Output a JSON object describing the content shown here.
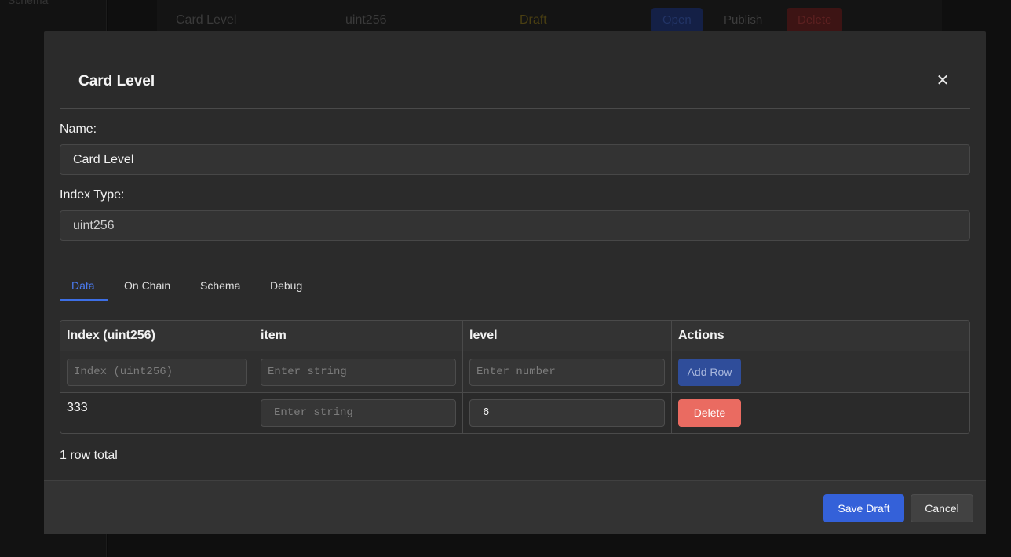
{
  "background": {
    "sidebar_text": "Schema",
    "row": {
      "name": "Card Level",
      "type": "uint256",
      "status": "Draft",
      "open_label": "Open",
      "publish_label": "Publish",
      "delete_label": "Delete"
    }
  },
  "modal": {
    "title": "Card Level",
    "close_icon": "close-icon",
    "name_label": "Name:",
    "name_value": "Card Level",
    "index_type_label": "Index Type:",
    "index_type_value": "uint256",
    "tabs": [
      {
        "label": "Data",
        "active": true
      },
      {
        "label": "On Chain",
        "active": false
      },
      {
        "label": "Schema",
        "active": false
      },
      {
        "label": "Debug",
        "active": false
      }
    ],
    "table": {
      "columns": [
        "Index (uint256)",
        "item",
        "level",
        "Actions"
      ],
      "new_row": {
        "index_placeholder": "Index (uint256)",
        "item_placeholder": "Enter string",
        "level_placeholder": "Enter number",
        "add_label": "Add Row"
      },
      "rows": [
        {
          "index": "333",
          "item_placeholder": "Enter string",
          "item": "",
          "level": "6",
          "delete_label": "Delete"
        }
      ]
    },
    "row_count": "1 row total",
    "footer": {
      "save_label": "Save Draft",
      "cancel_label": "Cancel"
    }
  },
  "colors": {
    "accent": "#3461d9",
    "danger": "#ea6b61",
    "tab_active": "#4b7bf0"
  }
}
